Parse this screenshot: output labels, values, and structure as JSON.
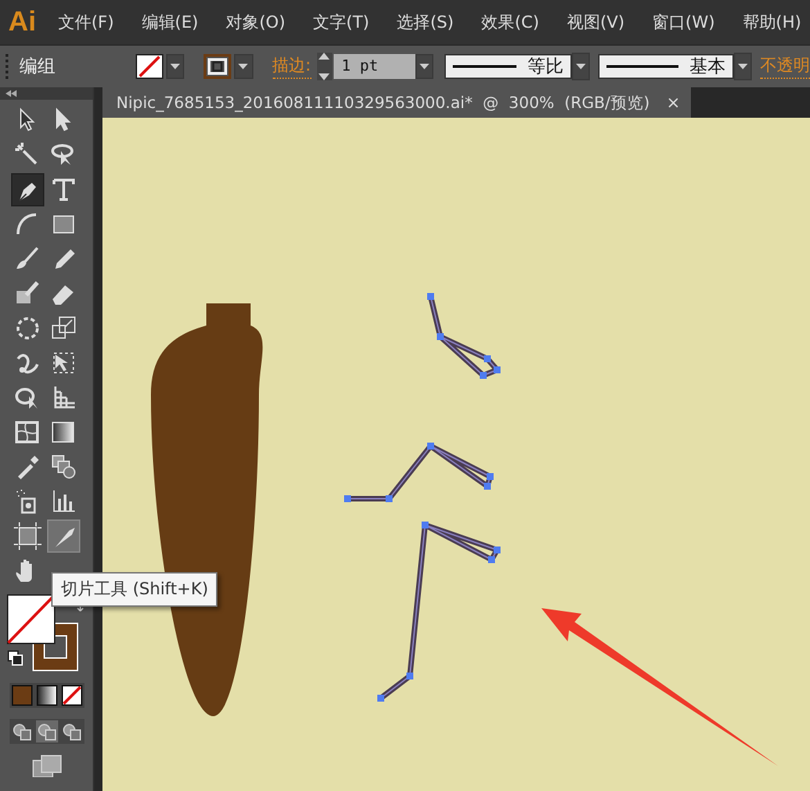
{
  "app": {
    "logo": "Ai"
  },
  "menu": [
    {
      "label": "文件(F)"
    },
    {
      "label": "编辑(E)"
    },
    {
      "label": "对象(O)"
    },
    {
      "label": "文字(T)"
    },
    {
      "label": "选择(S)"
    },
    {
      "label": "效果(C)"
    },
    {
      "label": "视图(V)"
    },
    {
      "label": "窗口(W)"
    },
    {
      "label": "帮助(H)"
    }
  ],
  "control_bar": {
    "selection_label": "编组",
    "stroke_label": "描边:",
    "stroke_weight": "1 pt",
    "profile": "等比",
    "brush": "基本",
    "opacity_label": "不透明"
  },
  "document_tab": {
    "title": "Nipic_7685153_20160811110329563000.ai*  @  300%  (RGB/预览)",
    "close": "×"
  },
  "tools": [
    {
      "kind": "selection",
      "selected": false,
      "hovered": false
    },
    {
      "kind": "direct",
      "selected": false,
      "hovered": false
    },
    {
      "kind": "wand",
      "selected": false,
      "hovered": false
    },
    {
      "kind": "lasso",
      "selected": false,
      "hovered": false
    },
    {
      "kind": "pen",
      "selected": true,
      "hovered": false
    },
    {
      "kind": "type",
      "selected": false,
      "hovered": false
    },
    {
      "kind": "arc",
      "selected": false,
      "hovered": false
    },
    {
      "kind": "rect",
      "selected": false,
      "hovered": false
    },
    {
      "kind": "brush",
      "selected": false,
      "hovered": false
    },
    {
      "kind": "pencil",
      "selected": false,
      "hovered": false
    },
    {
      "kind": "blob",
      "selected": false,
      "hovered": false
    },
    {
      "kind": "eraser",
      "selected": false,
      "hovered": false
    },
    {
      "kind": "rotate",
      "selected": false,
      "hovered": false
    },
    {
      "kind": "scale",
      "selected": false,
      "hovered": false
    },
    {
      "kind": "warp",
      "selected": false,
      "hovered": false
    },
    {
      "kind": "transform",
      "selected": false,
      "hovered": false
    },
    {
      "kind": "builder",
      "selected": false,
      "hovered": false
    },
    {
      "kind": "perspective",
      "selected": false,
      "hovered": false
    },
    {
      "kind": "mesh",
      "selected": false,
      "hovered": false
    },
    {
      "kind": "gradient",
      "selected": false,
      "hovered": false
    },
    {
      "kind": "eyedropper",
      "selected": false,
      "hovered": false
    },
    {
      "kind": "blend",
      "selected": false,
      "hovered": false
    },
    {
      "kind": "sprayer",
      "selected": false,
      "hovered": false
    },
    {
      "kind": "graph",
      "selected": false,
      "hovered": false
    },
    {
      "kind": "artboard",
      "selected": false,
      "hovered": false
    },
    {
      "kind": "slice",
      "selected": false,
      "hovered": true
    },
    {
      "kind": "hand",
      "selected": false,
      "hovered": false
    }
  ],
  "tooltip": {
    "text": "切片工具 (Shift+K)"
  }
}
